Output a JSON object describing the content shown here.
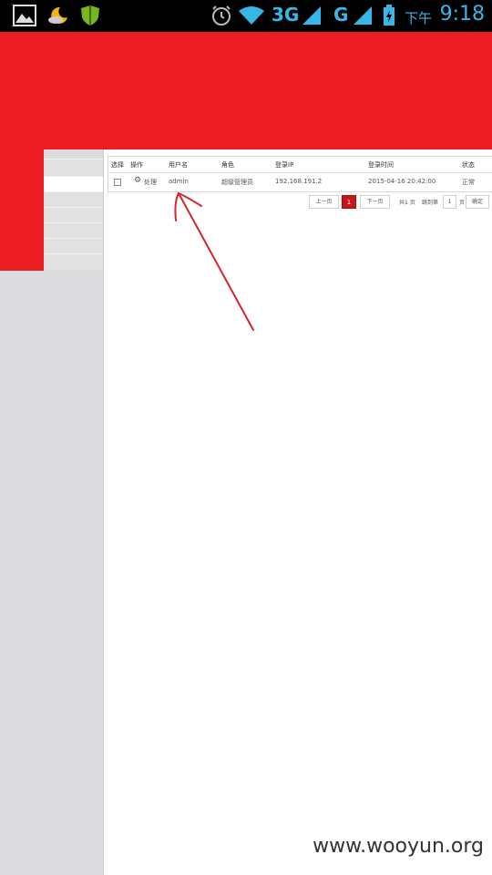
{
  "status_bar": {
    "network_3g": "3G",
    "network_g": "G",
    "ampm": "下午",
    "time": "9:18",
    "icons": [
      "picture-icon",
      "weather-icon",
      "shield-icon",
      "alarm-icon",
      "wifi-icon",
      "signal-icon",
      "battery-charging-icon"
    ]
  },
  "table": {
    "headers": {
      "select": "选择",
      "action": "操作",
      "username": "用户名",
      "role": "角色",
      "login_ip": "登录IP",
      "login_time": "登录时间",
      "status": "状态"
    },
    "rows": [
      {
        "action": "处理",
        "username": "admin",
        "role": "超级管理员",
        "login_ip": "192.168.191.2",
        "login_time": "2015-04-16 20:42:00",
        "status": "正常"
      }
    ]
  },
  "pager": {
    "prev": "上一页",
    "current": "1",
    "next": "下一页",
    "total_text": "共1 页",
    "jump_prefix": "跳到第",
    "jump_value": "1",
    "jump_suffix": "页",
    "confirm": "确定"
  },
  "colors": {
    "header_red": "#ee1c25",
    "sidebar_gray": "#dcdbdd",
    "status_blue": "#38b6e8"
  },
  "watermark": "www.wooyun.org"
}
